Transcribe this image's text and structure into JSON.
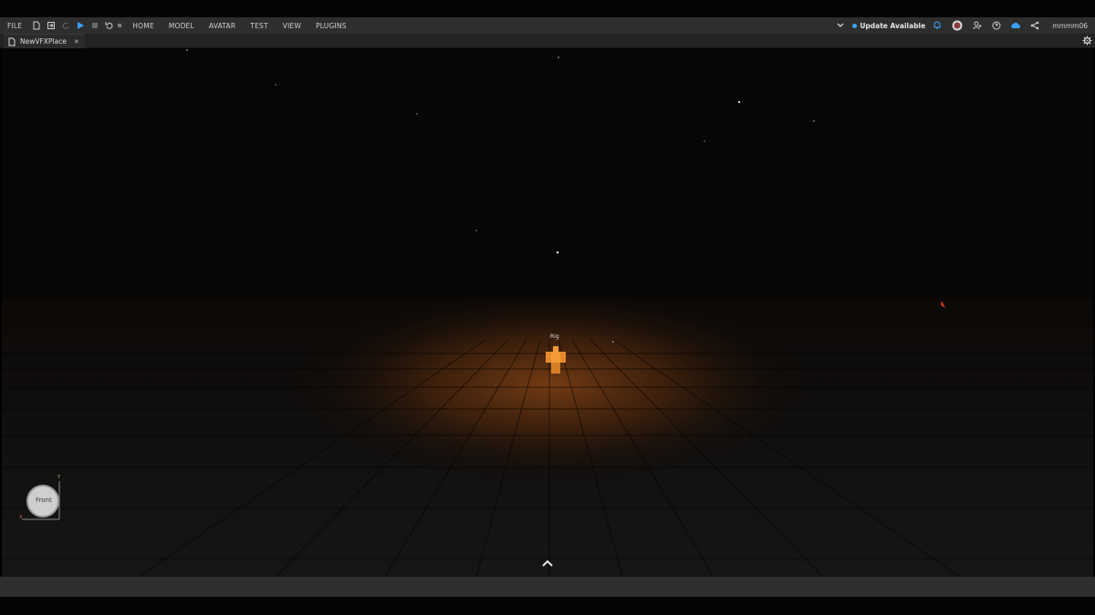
{
  "menubar": {
    "file_label": "FILE",
    "tabs": [
      "HOME",
      "MODEL",
      "AVATAR",
      "TEST",
      "VIEW",
      "PLUGINS"
    ],
    "update_label": "Update Available",
    "username": "mmmm06"
  },
  "tab": {
    "label": "NewVFXPlace",
    "close": "✕"
  },
  "viewport": {
    "rig_label": "Rig",
    "nav_cube": {
      "face": "Front",
      "axis_y": "Y",
      "axis_x": "X"
    }
  },
  "colors": {
    "accent": "#3aa0ff",
    "rig": "#f29a38",
    "toolbar_bg": "#2e2e2e"
  },
  "icons": [
    "new-file-icon",
    "open-file-icon",
    "redo-icon",
    "play-icon",
    "stop-icon",
    "undo-icon",
    "undo-dropdown-icon",
    "dropdown-chevron-icon",
    "notification-icon",
    "avatar-icon",
    "add-friend-icon",
    "help-icon",
    "cloud-icon",
    "share-icon",
    "settings-gear-icon",
    "caret-up-icon",
    "place-file-icon"
  ]
}
